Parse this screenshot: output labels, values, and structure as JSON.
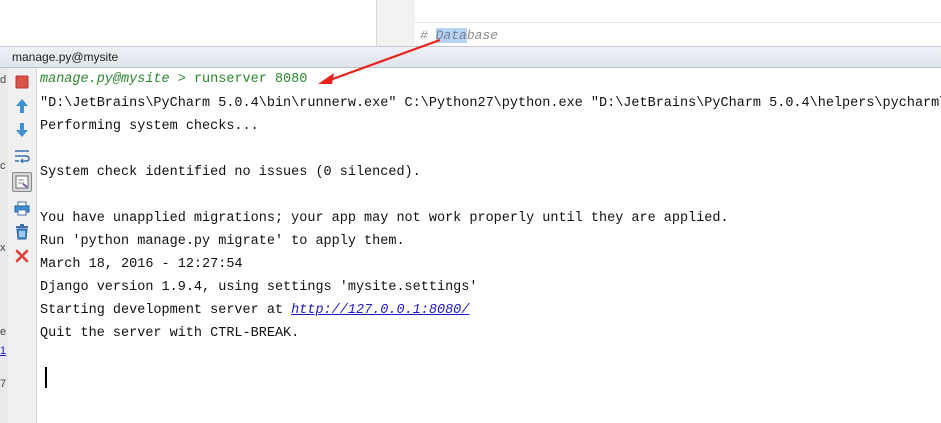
{
  "editor": {
    "comment_prefix": "# ",
    "comment_highlight": "Data",
    "comment_rest": "base"
  },
  "tool_window": {
    "title": "manage.py@mysite"
  },
  "left_strip": {
    "glyphs": [
      "d",
      "c",
      "x",
      "e",
      "1",
      "7"
    ]
  },
  "toolbar": {
    "icons": [
      "stop-icon",
      "scroll-up-icon",
      "scroll-down-icon",
      "soft-wrap-icon",
      "toggle-icon",
      "print-icon",
      "trash-icon",
      "close-icon"
    ]
  },
  "console": {
    "prompt_host": "manage.py@mysite",
    "prompt_sep": " > ",
    "prompt_cmd": "runserver 8080",
    "line_exec": "\"D:\\JetBrains\\PyCharm 5.0.4\\bin\\runnerw.exe\" C:\\Python27\\python.exe \"D:\\JetBrains\\PyCharm 5.0.4\\helpers\\pycharm\\d",
    "line_checks": "Performing system checks...",
    "line_issues": "System check identified no issues (0 silenced).",
    "line_unapplied": "You have unapplied migrations; your app may not work properly until they are applied.",
    "line_run": "Run 'python manage.py migrate' to apply them.",
    "line_date": "March 18, 2016 - 12:27:54",
    "line_django": "Django version 1.9.4, using settings 'mysite.settings'",
    "line_starting": "Starting development server at ",
    "link_url": "http://127.0.0.1:8080/",
    "line_quit": "Quit the server with CTRL-BREAK."
  },
  "colors": {
    "annotation_arrow": "#e8231c",
    "prompt_green": "#2b8a2f",
    "link_blue": "#1a1acc"
  }
}
